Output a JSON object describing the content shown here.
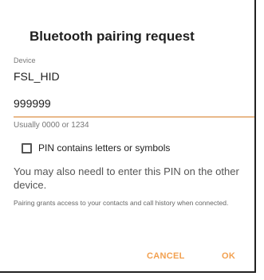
{
  "dialog": {
    "title": "Bluetooth pairing request",
    "device_caption": "Device",
    "device_name": "FSL_HID",
    "pin_value": "999999",
    "pin_hint": "Usually 0000 or 1234",
    "checkbox_label": "PIN contains letters or symbols",
    "checkbox_checked": false,
    "note_main": "You may also needl to enter this PIN on the other device.",
    "note_small": "Pairing grants access to your contacts and call history when connected.",
    "accent_color": "#f2a04f"
  },
  "actions": {
    "cancel_label": "CANCEL",
    "ok_label": "OK"
  }
}
